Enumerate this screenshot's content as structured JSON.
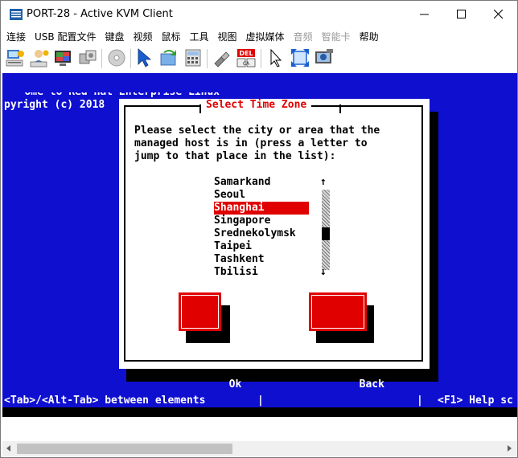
{
  "window": {
    "title": "PORT-28 - Active KVM Client"
  },
  "menu": {
    "items": [
      {
        "label": "连接",
        "enabled": true
      },
      {
        "label": "USB 配置文件",
        "enabled": true
      },
      {
        "label": "键盘",
        "enabled": true
      },
      {
        "label": "视频",
        "enabled": true
      },
      {
        "label": "鼠标",
        "enabled": true
      },
      {
        "label": "工具",
        "enabled": true
      },
      {
        "label": "视图",
        "enabled": true
      },
      {
        "label": "虚拟媒体",
        "enabled": true
      },
      {
        "label": "音频",
        "enabled": false
      },
      {
        "label": "智能卡",
        "enabled": false
      },
      {
        "label": "帮助",
        "enabled": true
      }
    ]
  },
  "toolbar": {
    "icons": [
      "keyboard-settings-icon",
      "user-settings-icon",
      "video-settings-icon",
      "connect-devices-icon",
      "disc-icon",
      "align-mouse-icon",
      "refresh-icon",
      "calculator-icon",
      "plug-icon",
      "ctrl-alt-del-icon",
      "single-cursor-icon",
      "fullscreen-icon",
      "screenshot-icon"
    ],
    "del_label": "DEL",
    "altctrl_label": "CA"
  },
  "console": {
    "bg_line1": "   ome to Red Hat Enterprise Linux  ",
    "bg_line2": "pyright (c) 2018",
    "dialog": {
      "title": "Select Time Zone",
      "prompt_line1": "Please select the city or area that the",
      "prompt_line2": "managed host is in (press a letter to",
      "prompt_line3": "jump to that place in the list):",
      "cities": [
        "Samarkand",
        "Seoul",
        "Shanghai",
        "Singapore",
        "Srednekolymsk",
        "Taipei",
        "Tashkent",
        "Tbilisi"
      ],
      "selected_city": "Shanghai",
      "scroll_up": "↑",
      "scroll_down": "↓",
      "ok_label": "Ok",
      "back_label": "Back"
    },
    "status_left": "<Tab>/<Alt-Tab> between elements",
    "status_sep1": "|",
    "status_sep2": "|",
    "status_right": "<F1> Help sc"
  },
  "colors": {
    "console_bg": "#0f0fd0",
    "accent_red": "#e00000"
  }
}
